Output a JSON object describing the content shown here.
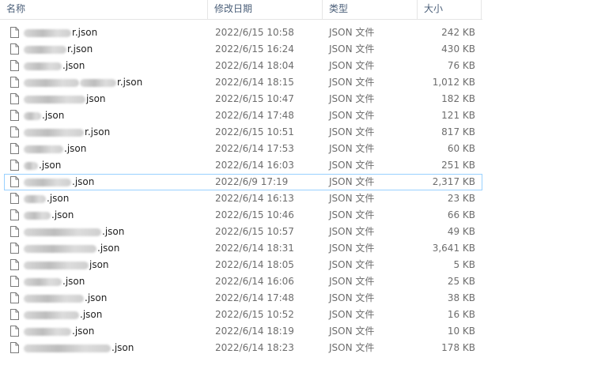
{
  "header": {
    "name_label": "名称",
    "date_label": "修改日期",
    "type_label": "类型",
    "size_label": "大小"
  },
  "files": [
    {
      "suffix": "r.json",
      "modified": "2022/6/15 10:58",
      "type": "JSON 文件",
      "size": "242 KB"
    },
    {
      "suffix": "r.json",
      "modified": "2022/6/15 16:24",
      "type": "JSON 文件",
      "size": "430 KB"
    },
    {
      "suffix": ".json",
      "modified": "2022/6/14 18:04",
      "type": "JSON 文件",
      "size": "76 KB"
    },
    {
      "suffix": "r.json",
      "modified": "2022/6/14 18:15",
      "type": "JSON 文件",
      "size": "1,012 KB"
    },
    {
      "suffix": "json",
      "modified": "2022/6/15 10:47",
      "type": "JSON 文件",
      "size": "182 KB"
    },
    {
      "suffix": ".json",
      "modified": "2022/6/14 17:48",
      "type": "JSON 文件",
      "size": "121 KB"
    },
    {
      "suffix": "r.json",
      "modified": "2022/6/15 10:51",
      "type": "JSON 文件",
      "size": "817 KB"
    },
    {
      "suffix": ".json",
      "modified": "2022/6/14 17:53",
      "type": "JSON 文件",
      "size": "60 KB"
    },
    {
      "suffix": ".json",
      "modified": "2022/6/14 16:03",
      "type": "JSON 文件",
      "size": "251 KB"
    },
    {
      "suffix": ".json",
      "modified": "2022/6/9 17:19",
      "type": "JSON 文件",
      "size": "2,317 KB"
    },
    {
      "suffix": ".json",
      "modified": "2022/6/14 16:13",
      "type": "JSON 文件",
      "size": "23 KB"
    },
    {
      "suffix": ".json",
      "modified": "2022/6/15 10:46",
      "type": "JSON 文件",
      "size": "66 KB"
    },
    {
      "suffix": ".json",
      "modified": "2022/6/15 10:57",
      "type": "JSON 文件",
      "size": "49 KB"
    },
    {
      "suffix": ".json",
      "modified": "2022/6/14 18:31",
      "type": "JSON 文件",
      "size": "3,641 KB"
    },
    {
      "suffix": "json",
      "modified": "2022/6/14 18:05",
      "type": "JSON 文件",
      "size": "5 KB"
    },
    {
      "suffix": ".json",
      "modified": "2022/6/14 16:06",
      "type": "JSON 文件",
      "size": "25 KB"
    },
    {
      "suffix": ".json",
      "modified": "2022/6/14 17:48",
      "type": "JSON 文件",
      "size": "38 KB"
    },
    {
      "suffix": ".json",
      "modified": "2022/6/15 10:52",
      "type": "JSON 文件",
      "size": "16 KB"
    },
    {
      "suffix": ".json",
      "modified": "2022/6/14 18:19",
      "type": "JSON 文件",
      "size": "10 KB"
    },
    {
      "suffix": ".json",
      "modified": "2022/6/14 18:23",
      "type": "JSON 文件",
      "size": "178 KB"
    }
  ]
}
